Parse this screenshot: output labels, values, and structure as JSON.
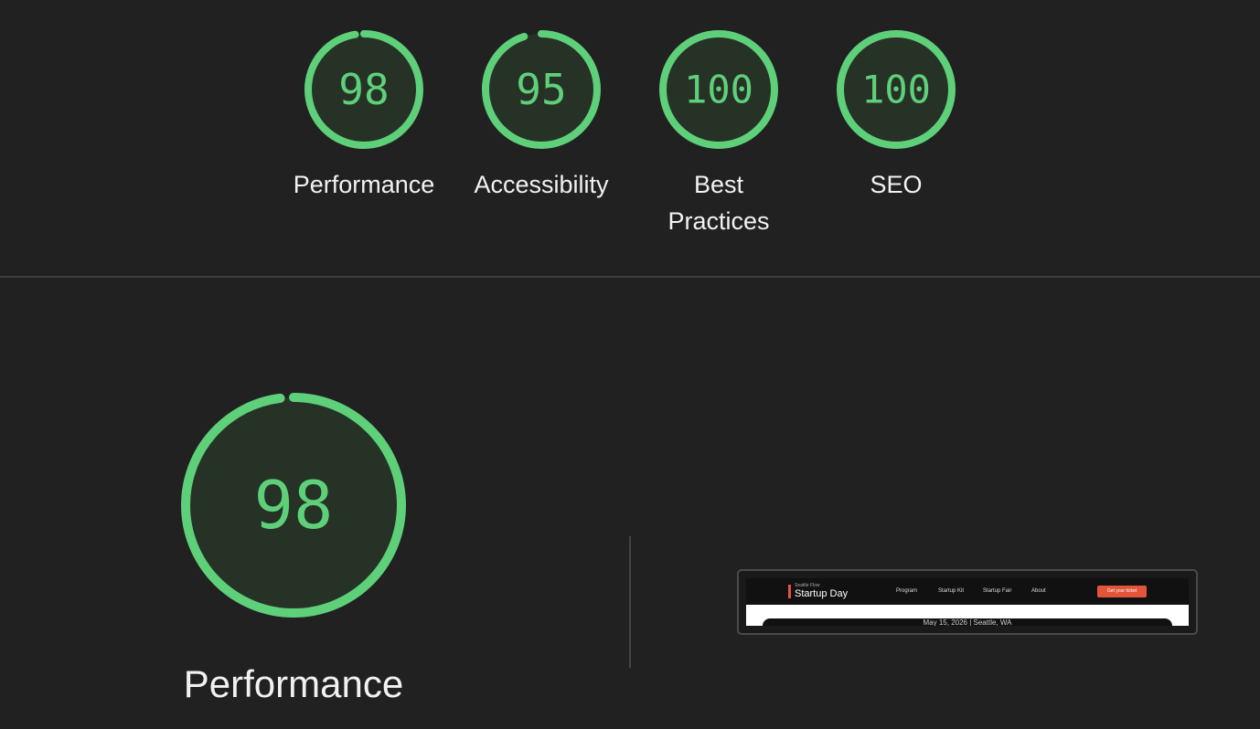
{
  "colors": {
    "pass": "#5fd07a",
    "gauge_fill": "#273227",
    "background": "#212121"
  },
  "gauges": [
    {
      "score": 98,
      "label": "Performance"
    },
    {
      "score": 95,
      "label": "Accessibility"
    },
    {
      "score": 100,
      "label": "Best Practices"
    },
    {
      "score": 100,
      "label": "SEO"
    }
  ],
  "category": {
    "score": 98,
    "title": "Performance"
  },
  "thumbnail": {
    "brand_small": "Seattle Flow",
    "brand": "Startup Day",
    "menu": [
      "Program",
      "Startup Kit",
      "Startup Fair",
      "About"
    ],
    "cta": "Get your ticket",
    "date_line": "May 15, 2026 | Seattle, WA"
  }
}
